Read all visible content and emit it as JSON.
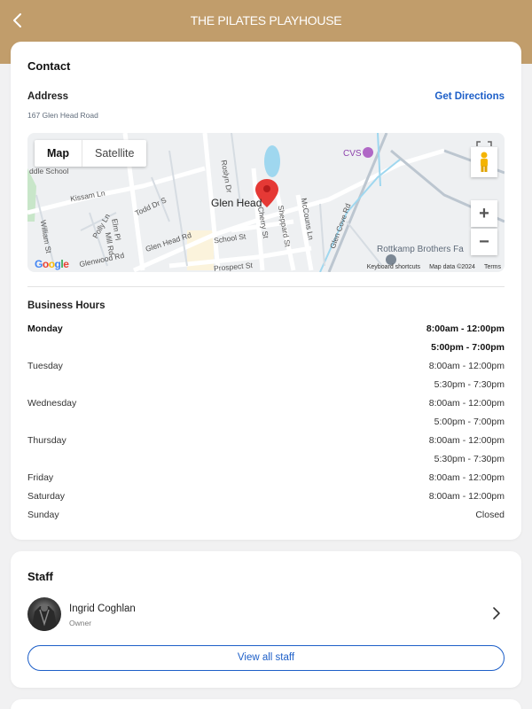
{
  "header": {
    "title": "THE PILATES PLAYHOUSE"
  },
  "contact": {
    "title": "Contact",
    "address_label": "Address",
    "address_value": "167 Glen Head Road",
    "directions_label": "Get Directions",
    "map": {
      "tabs": [
        "Map",
        "Satellite"
      ],
      "selected_tab": "Map",
      "city_label": "Glen Head",
      "place_labels": [
        "CVS",
        "Rottkamp Brothers Fa",
        "Kissam Ln",
        "Todd Dr S",
        "Glen Head Rd",
        "School St",
        "Prospect St",
        "Glenwood Rd",
        "Sheppard St",
        "Cherry St",
        "Glen Cove Rd",
        "McCouns Ln",
        "Roslyn Dr",
        "Polly Ln",
        "Mill Rd",
        "Elm Pl",
        "William St",
        "ddle School"
      ],
      "zoom_in": "+",
      "zoom_out": "−",
      "footer_shortcuts": "Keyboard shortcuts",
      "footer_data": "Map data ©2024",
      "footer_terms": "Terms",
      "logo": "Google"
    },
    "hours_title": "Business Hours",
    "hours": [
      {
        "day": "Monday",
        "time": "8:00am - 12:00pm",
        "today": true
      },
      {
        "day": "",
        "time": "5:00pm - 7:00pm",
        "today": true
      },
      {
        "day": "Tuesday",
        "time": "8:00am - 12:00pm",
        "today": false
      },
      {
        "day": "",
        "time": "5:30pm - 7:30pm",
        "today": false
      },
      {
        "day": "Wednesday",
        "time": "8:00am - 12:00pm",
        "today": false
      },
      {
        "day": "",
        "time": "5:00pm - 7:00pm",
        "today": false
      },
      {
        "day": "Thursday",
        "time": "8:00am - 12:00pm",
        "today": false
      },
      {
        "day": "",
        "time": "5:30pm - 7:30pm",
        "today": false
      },
      {
        "day": "Friday",
        "time": "8:00am - 12:00pm",
        "today": false
      },
      {
        "day": "Saturday",
        "time": "8:00am - 12:00pm",
        "today": false
      },
      {
        "day": "Sunday",
        "time": "Closed",
        "today": false
      }
    ]
  },
  "staff": {
    "title": "Staff",
    "members": [
      {
        "name": "Ingrid Coghlan",
        "role": "Owner"
      }
    ],
    "view_all_label": "View all staff"
  },
  "colors": {
    "header_bg": "#c19d6b",
    "accent": "#1d5fc8",
    "map_pin": "#e53935"
  },
  "icons": {
    "back": "chevron-left-icon",
    "staff_chevron": "chevron-right-icon",
    "map_pin": "location-pin-icon",
    "pegman": "street-view-icon",
    "fullscreen": "fullscreen-icon"
  }
}
